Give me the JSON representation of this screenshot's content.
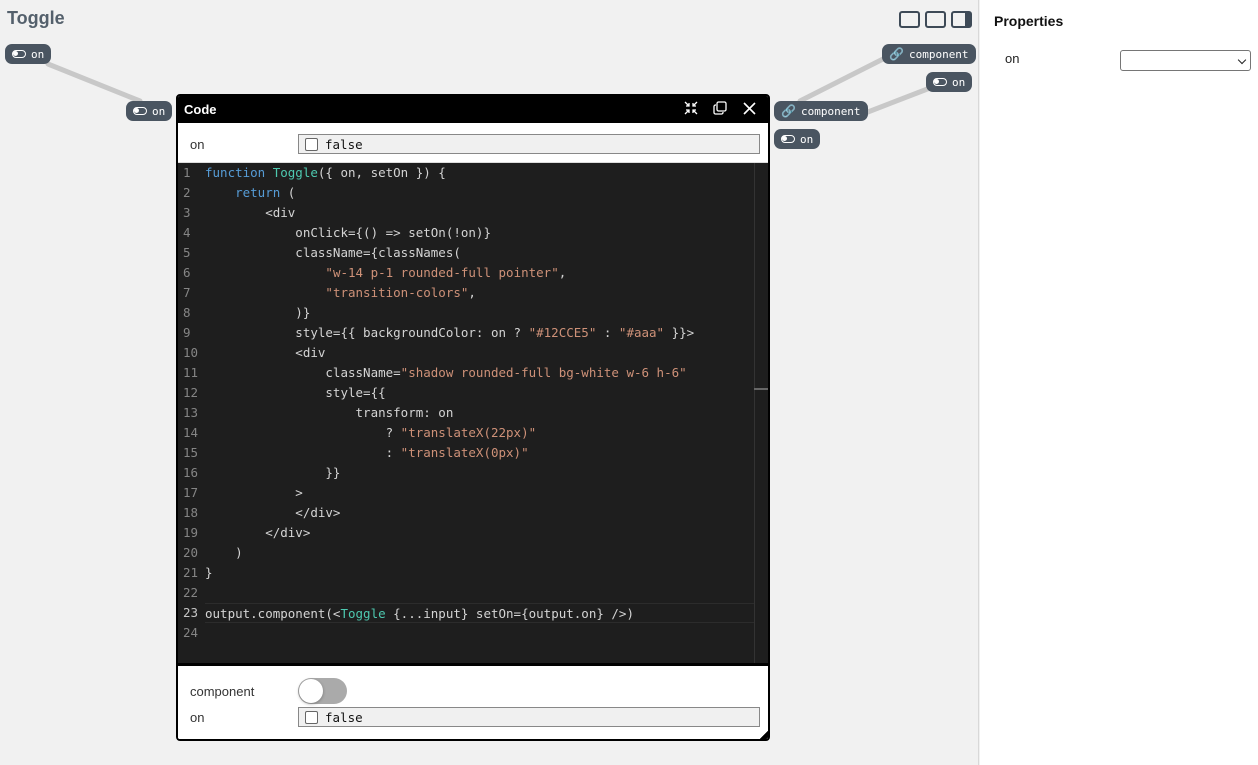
{
  "page": {
    "title": "Toggle"
  },
  "canvas_ports": {
    "left_outer_on": "on",
    "left_inner_on": "on",
    "right_outer_component": "component",
    "right_outer_on": "on",
    "right_inner_component": "component",
    "right_inner_on": "on"
  },
  "code_window": {
    "title": "Code",
    "input": {
      "label": "on",
      "value": "false"
    },
    "lines": [
      "1",
      "2",
      "3",
      "4",
      "5",
      "6",
      "7",
      "8",
      "9",
      "10",
      "11",
      "12",
      "13",
      "14",
      "15",
      "16",
      "17",
      "18",
      "19",
      "20",
      "21",
      "22",
      "23",
      "24"
    ],
    "code": [
      [
        {
          "t": "kw",
          "v": "function "
        },
        {
          "t": "fn",
          "v": "Toggle"
        },
        {
          "t": "p",
          "v": "({ on, setOn }) {"
        }
      ],
      [
        {
          "t": "p",
          "v": "    "
        },
        {
          "t": "kw",
          "v": "return"
        },
        {
          "t": "p",
          "v": " ("
        }
      ],
      [
        {
          "t": "p",
          "v": "        <div"
        }
      ],
      [
        {
          "t": "p",
          "v": "            onClick={() => setOn(!on)}"
        }
      ],
      [
        {
          "t": "p",
          "v": "            className={classNames("
        }
      ],
      [
        {
          "t": "p",
          "v": "                "
        },
        {
          "t": "str",
          "v": "\"w-14 p-1 rounded-full pointer\""
        },
        {
          "t": "p",
          "v": ","
        }
      ],
      [
        {
          "t": "p",
          "v": "                "
        },
        {
          "t": "str",
          "v": "\"transition-colors\""
        },
        {
          "t": "p",
          "v": ","
        }
      ],
      [
        {
          "t": "p",
          "v": "            )}"
        }
      ],
      [
        {
          "t": "p",
          "v": "            style={{ backgroundColor: on ? "
        },
        {
          "t": "str",
          "v": "\"#12CCE5\""
        },
        {
          "t": "p",
          "v": " : "
        },
        {
          "t": "str",
          "v": "\"#aaa\""
        },
        {
          "t": "p",
          "v": " }}>"
        }
      ],
      [
        {
          "t": "p",
          "v": "            <div"
        }
      ],
      [
        {
          "t": "p",
          "v": "                className="
        },
        {
          "t": "str",
          "v": "\"shadow rounded-full bg-white w-6 h-6\""
        }
      ],
      [
        {
          "t": "p",
          "v": "                style={{"
        }
      ],
      [
        {
          "t": "p",
          "v": "                    transform: on"
        }
      ],
      [
        {
          "t": "p",
          "v": "                        ? "
        },
        {
          "t": "str",
          "v": "\"translateX(22px)\""
        }
      ],
      [
        {
          "t": "p",
          "v": "                        : "
        },
        {
          "t": "str",
          "v": "\"translateX(0px)\""
        }
      ],
      [
        {
          "t": "p",
          "v": "                }}"
        }
      ],
      [
        {
          "t": "p",
          "v": "            >"
        }
      ],
      [
        {
          "t": "p",
          "v": "            </div>"
        }
      ],
      [
        {
          "t": "p",
          "v": "        </div>"
        }
      ],
      [
        {
          "t": "p",
          "v": "    )"
        }
      ],
      [
        {
          "t": "p",
          "v": "}"
        }
      ],
      [
        {
          "t": "p",
          "v": ""
        }
      ],
      [
        {
          "t": "p",
          "v": "output.component(<"
        },
        {
          "t": "fn",
          "v": "Toggle"
        },
        {
          "t": "p",
          "v": " {...input} setOn={output.on} />)"
        }
      ],
      [
        {
          "t": "p",
          "v": ""
        }
      ]
    ],
    "active_line": 23,
    "output": {
      "component_label": "component",
      "on_label": "on",
      "on_value": "false"
    }
  },
  "properties": {
    "title": "Properties",
    "on_label": "on",
    "on_value": ""
  },
  "colors": {
    "port_bg": "#4a5561",
    "editor_bg": "#1e1e1e",
    "keyword": "#569cd6",
    "function": "#4ec9b0",
    "string": "#ce9178"
  }
}
